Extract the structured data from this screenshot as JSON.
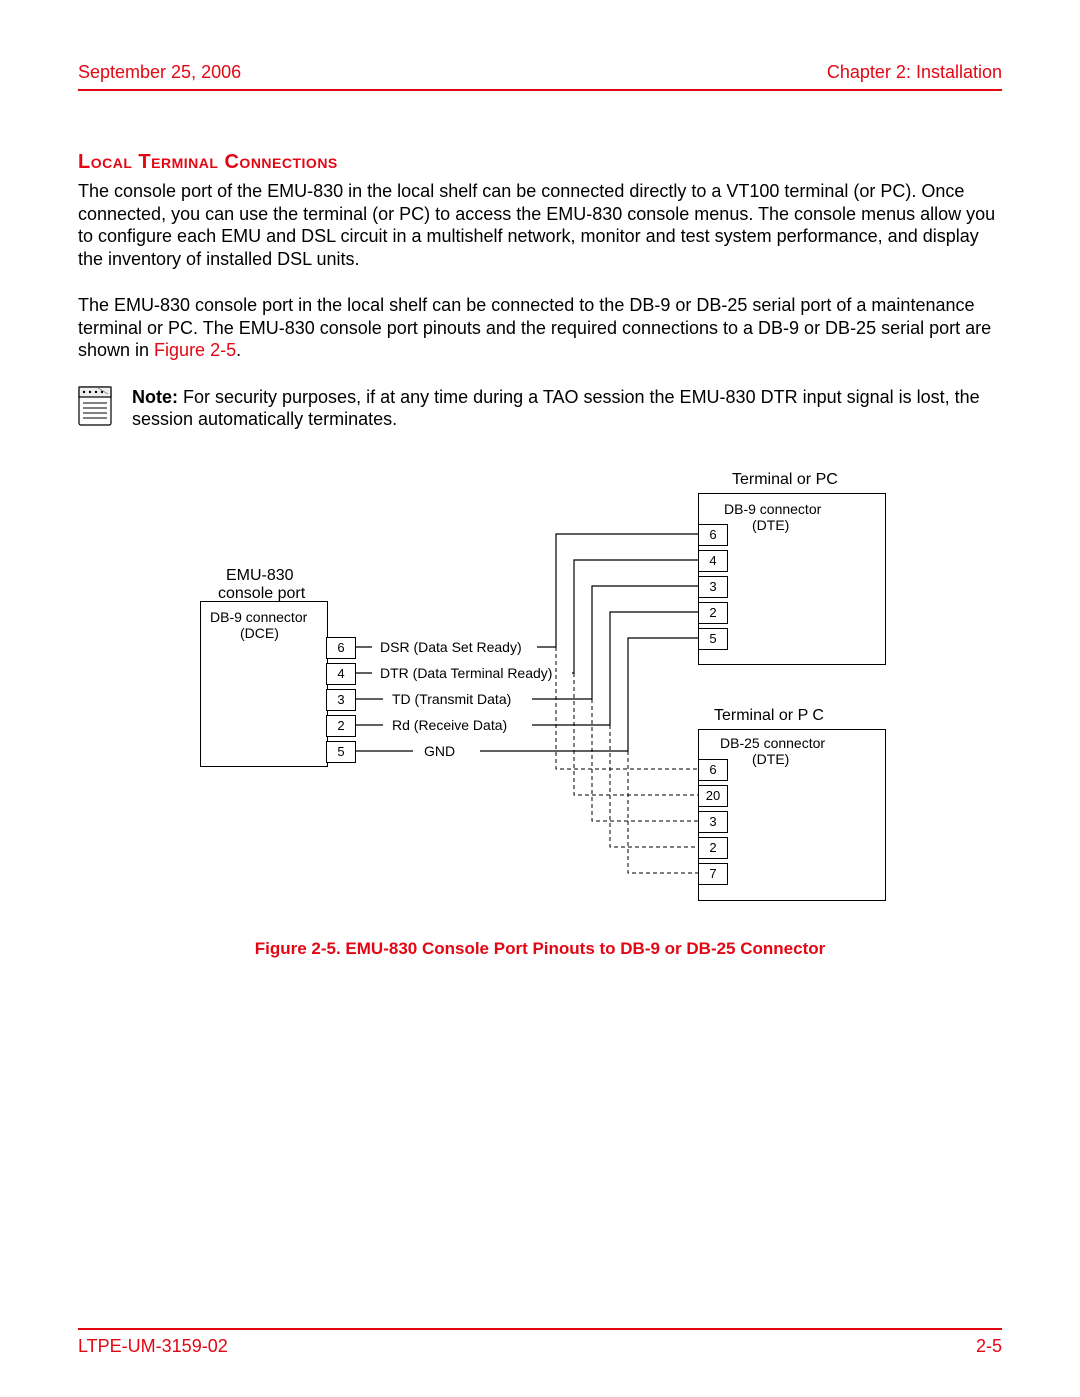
{
  "header": {
    "date": "September 25, 2006",
    "chapter": "Chapter 2: Installation"
  },
  "section_title": "Local Terminal Connections",
  "paragraph1": "The console port of the EMU-830 in the local shelf can be connected directly to a VT100 terminal (or PC). Once connected, you can use the terminal (or PC) to access the EMU-830 console menus. The console menus allow you to configure each EMU and DSL circuit in a multishelf network, monitor and test system performance, and display the inventory of installed DSL units.",
  "paragraph2a": "The EMU-830 console port in the local shelf can be connected to the DB-9 or DB-25 serial port of a maintenance terminal or PC. The EMU-830 console port pinouts and the required connections to a DB-9 or DB-25 serial port are shown in ",
  "paragraph2_link": "Figure 2-5",
  "paragraph2b": ".",
  "note_label": "Note:",
  "note_text": " For security purposes, if at any time during a TAO session the EMU-830 DTR input signal is lost, the session automatically terminates.",
  "diagram": {
    "emu": {
      "title1": "EMU-830",
      "title2": "console port",
      "conn1": "DB-9 connector",
      "conn2": "(DCE)",
      "pins": [
        "6",
        "4",
        "3",
        "2",
        "5"
      ]
    },
    "signals": {
      "dsr": "DSR (Data Set Ready)",
      "dtr": "DTR (Data Terminal Ready)",
      "td": "TD (Transmit Data)",
      "rd": "Rd (Receive Data)",
      "gnd": "GND"
    },
    "term9": {
      "title": "Terminal or PC",
      "conn1": "DB-9 connector",
      "conn2": "(DTE)",
      "pins": [
        "6",
        "4",
        "3",
        "2",
        "5"
      ]
    },
    "term25": {
      "title": "Terminal or P      C",
      "conn1": "DB-25 connector",
      "conn2": "(DTE)",
      "pins": [
        "6",
        "20",
        "3",
        "2",
        "7"
      ]
    }
  },
  "figure_caption": "Figure 2-5. EMU-830 Console Port Pinouts to DB-9 or DB-25 Connector",
  "footer": {
    "doc": "LTPE-UM-3159-02",
    "page": "2-5"
  }
}
